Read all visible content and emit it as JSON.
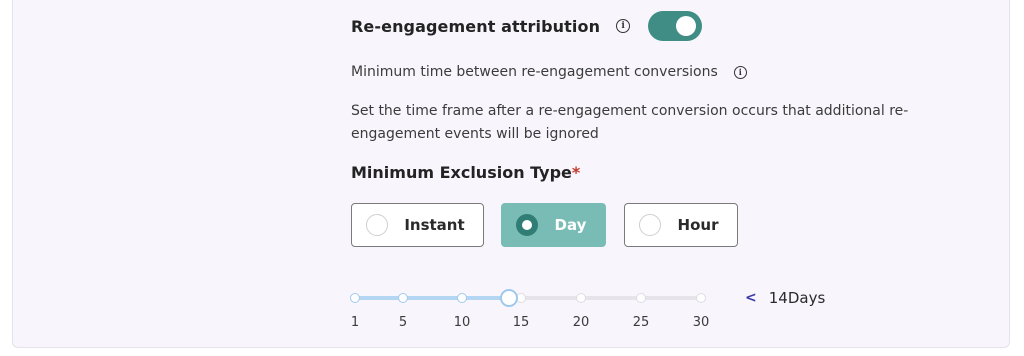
{
  "attribution": {
    "title": "Re-engagement attribution",
    "info_icon": "info-icon",
    "toggle_on": true,
    "toggle_color": "#3f8d84"
  },
  "min_time": {
    "label": "Minimum time between re-engagement conversions",
    "info_icon": "info-icon"
  },
  "description": "Set the time frame after a re-engagement conversion occurs that additional re-engagement events will be ignored",
  "exclusion": {
    "label": "Minimum Exclusion Type",
    "required_mark": "*",
    "options": [
      {
        "label": "Instant",
        "selected": false
      },
      {
        "label": "Day",
        "selected": true
      },
      {
        "label": "Hour",
        "selected": false
      }
    ],
    "selected_color": "#79bcb5"
  },
  "slider": {
    "ticks": [
      "1",
      "5",
      "10",
      "15",
      "20",
      "25",
      "30"
    ],
    "value": 14,
    "min": 1,
    "max": 30,
    "display_chevron": "<",
    "display_value": "14Days"
  }
}
